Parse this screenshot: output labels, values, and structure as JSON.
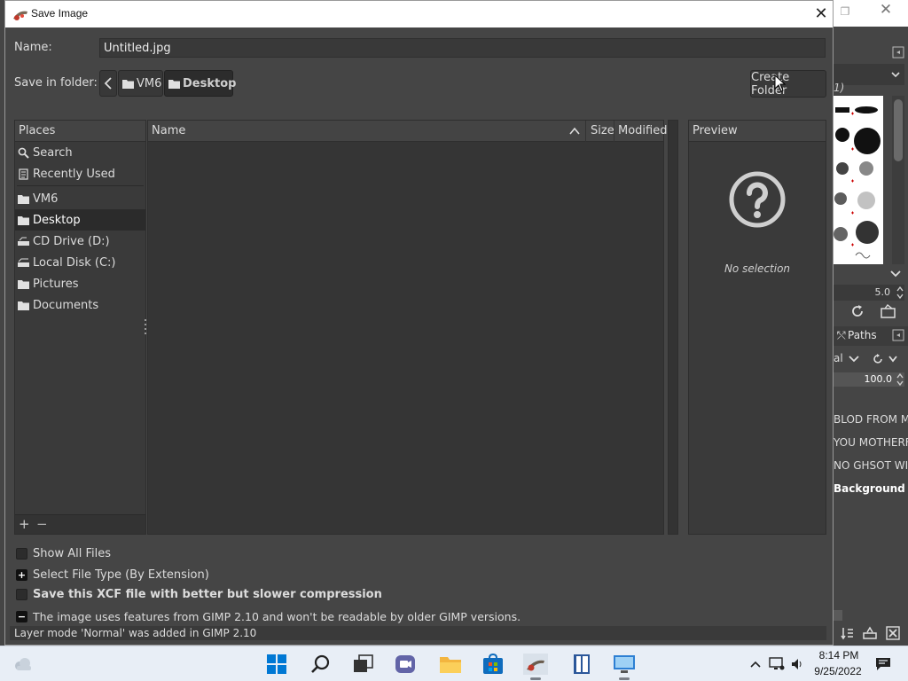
{
  "dialog": {
    "title": "Save Image",
    "close_glyph": "✕",
    "name_label": "Name:",
    "name_value": "Untitled.jpg",
    "save_in_label": "Save in folder:",
    "breadcrumbs": [
      "VM6",
      "Desktop"
    ],
    "create_folder_label": "Create Folder"
  },
  "places": {
    "header": "Places",
    "items": [
      {
        "label": "Search",
        "icon": "search-icon"
      },
      {
        "label": "Recently Used",
        "icon": "recent-icon"
      },
      {
        "label": "VM6",
        "icon": "folder-icon"
      },
      {
        "label": "Desktop",
        "icon": "folder-icon",
        "selected": true
      },
      {
        "label": "CD Drive (D:)",
        "icon": "cd-drive-icon"
      },
      {
        "label": "Local Disk (C:)",
        "icon": "disk-icon"
      },
      {
        "label": "Pictures",
        "icon": "folder-icon"
      },
      {
        "label": "Documents",
        "icon": "folder-icon"
      }
    ],
    "add_glyph": "+",
    "remove_glyph": "−"
  },
  "file_list": {
    "columns": [
      "Name",
      "Size",
      "Modified"
    ],
    "rows": []
  },
  "preview": {
    "header": "Preview",
    "empty_text": "No selection"
  },
  "options": {
    "show_all_files": "Show All Files",
    "select_file_type": "Select File Type (By Extension)",
    "xcf_compression": "Save this XCF file with better but slower compression",
    "compat_notice": "The image uses features from GIMP 2.10 and won't be readable by older GIMP versions.",
    "status": "Layer mode 'Normal' was added in GIMP 2.10",
    "expander_plus": "+",
    "expander_minus": "−"
  },
  "background_app": {
    "restore_glyph": "❐",
    "close_glyph": "✕",
    "brush_name_fragment": "1)",
    "spacing_value": "5.0",
    "paths_tab": "Paths",
    "mode_fragment": "al",
    "opacity_value": "100.0",
    "layers": [
      "BLOD FROM MC",
      "YOU MOTHERFU",
      "NO GHSOT WIL I",
      "Background"
    ]
  },
  "taskbar": {
    "time": "8:14 PM",
    "date": "9/25/2022",
    "accent": "#0078d4"
  }
}
